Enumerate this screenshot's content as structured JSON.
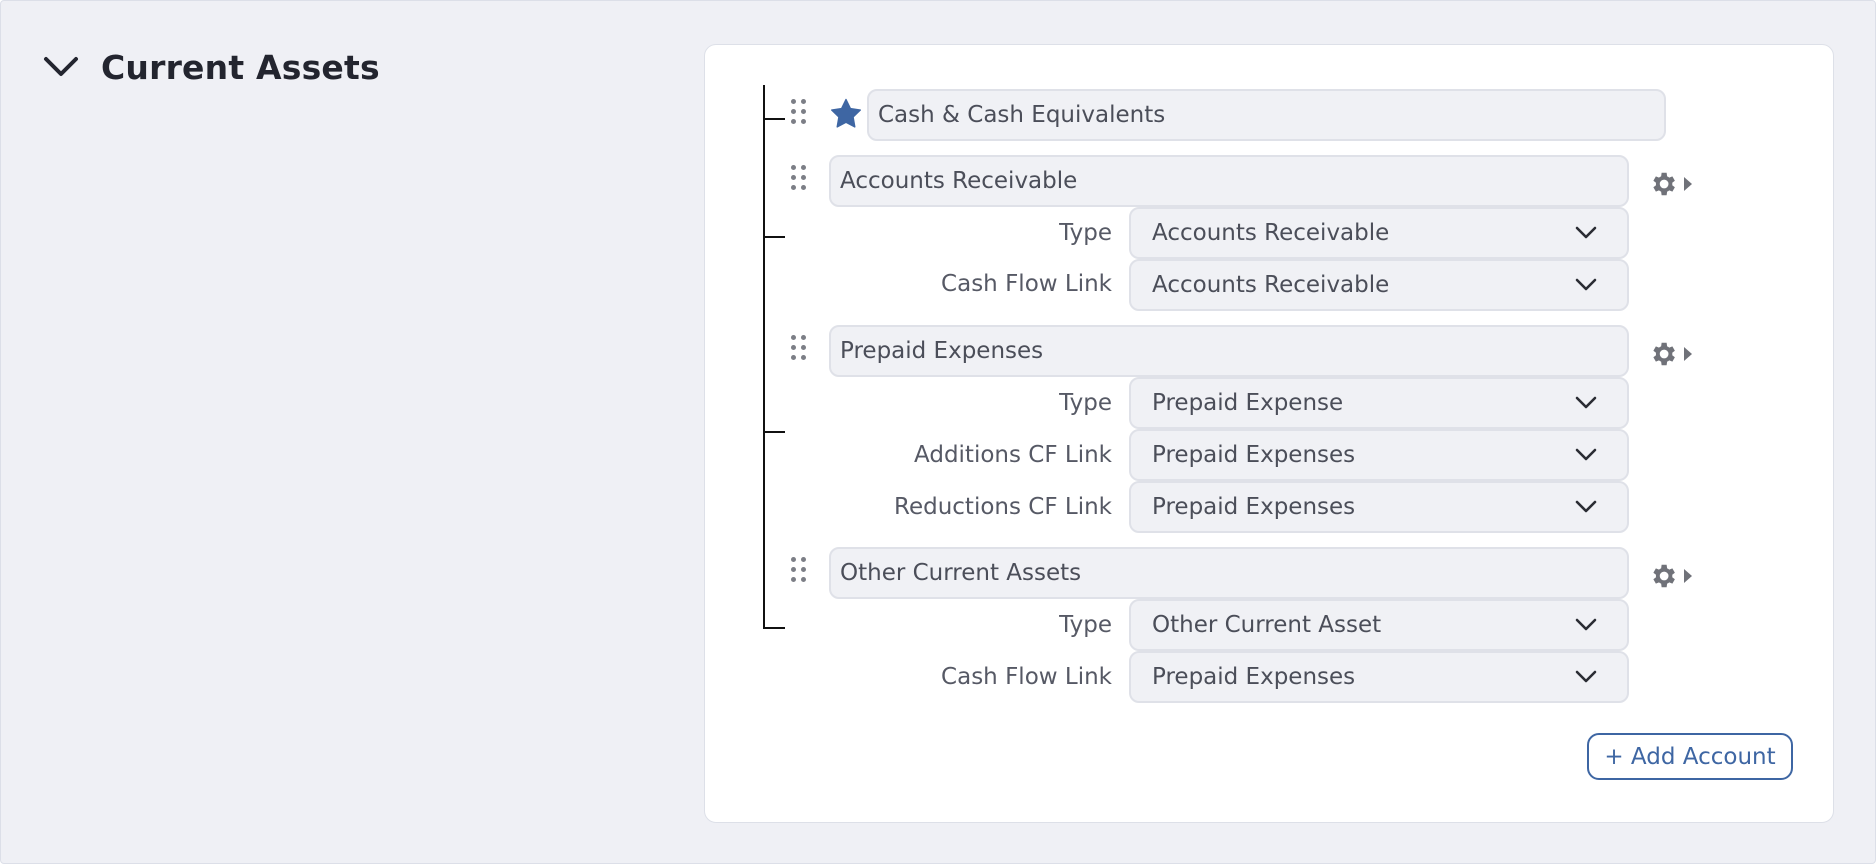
{
  "section": {
    "title": "Current Assets",
    "collapse_icon": "chevron-down-icon"
  },
  "accounts": [
    {
      "name": "Cash & Cash Equivalents",
      "favorite_icon": "star-icon"
    },
    {
      "name": "Accounts Receivable",
      "fields": [
        {
          "label": "Type",
          "value": "Accounts Receivable"
        },
        {
          "label": "Cash Flow Link",
          "value": "Accounts Receivable"
        }
      ]
    },
    {
      "name": "Prepaid Expenses",
      "fields": [
        {
          "label": "Type",
          "value": "Prepaid Expense"
        },
        {
          "label": "Additions CF Link",
          "value": "Prepaid Expenses"
        },
        {
          "label": "Reductions CF Link",
          "value": "Prepaid Expenses"
        }
      ]
    },
    {
      "name": "Other Current Assets",
      "fields": [
        {
          "label": "Type",
          "value": "Other Current Asset"
        },
        {
          "label": "Cash Flow Link",
          "value": "Prepaid Expenses"
        }
      ]
    }
  ],
  "actions": {
    "add_account_label": "+ Add Account"
  },
  "colors": {
    "accent": "#3e66a3",
    "background": "#eff0f5",
    "field_bg": "#f0f1f5",
    "star": "#3e66a3"
  }
}
